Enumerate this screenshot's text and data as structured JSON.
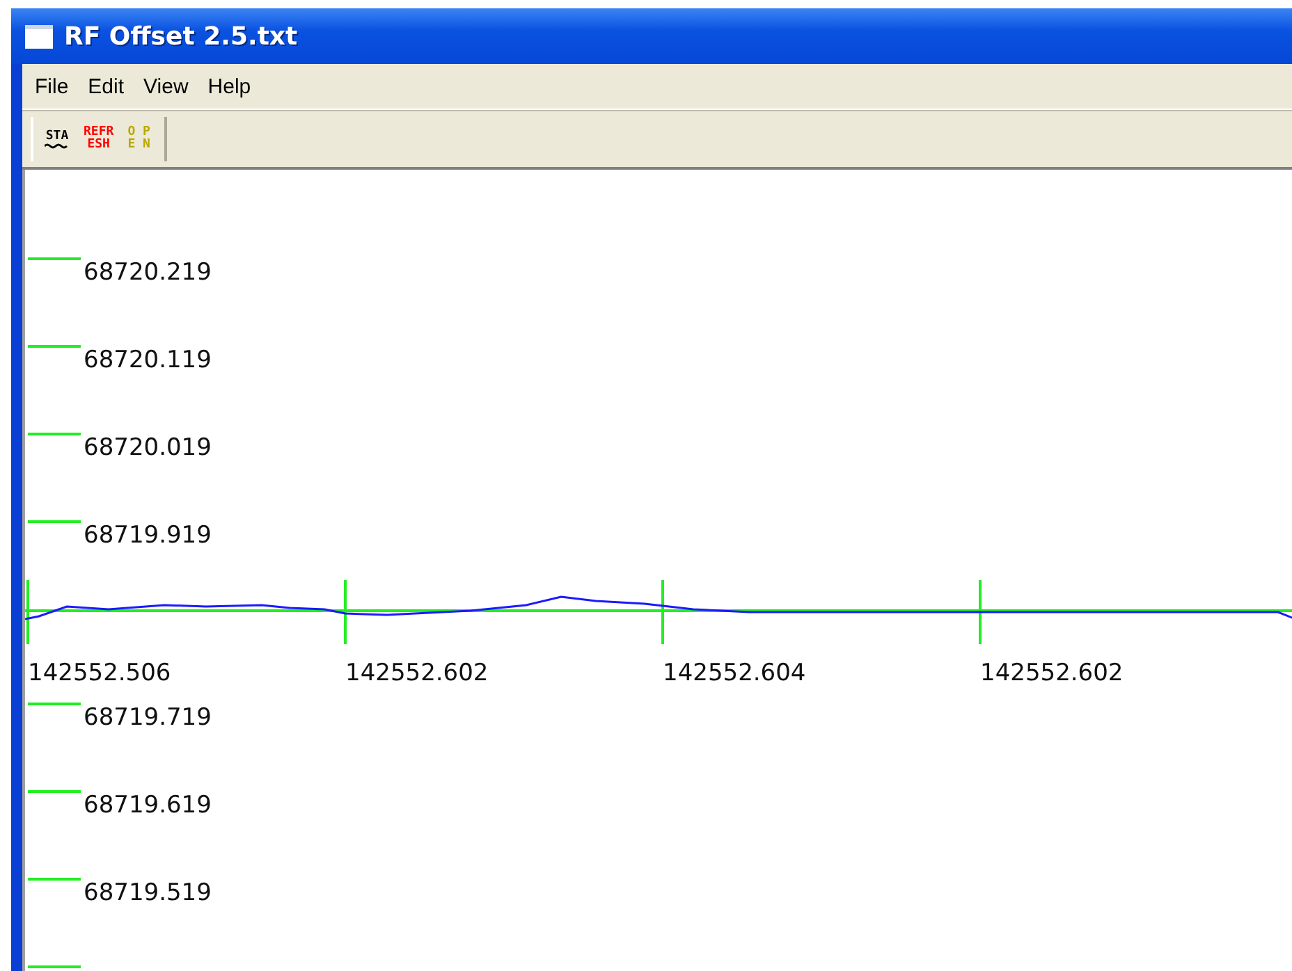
{
  "window": {
    "title": "RF Offset 2.5.txt"
  },
  "menu": [
    "File",
    "Edit",
    "View",
    "Help"
  ],
  "toolbar": [
    {
      "lines": [
        "STA"
      ],
      "color": "#000000",
      "wavy": true
    },
    {
      "lines": [
        "REFR",
        "ESH"
      ],
      "color": "#ff0000",
      "wavy": false
    },
    {
      "lines": [
        "O P",
        "E N"
      ],
      "color": "#b8a800",
      "wavy": false
    }
  ],
  "plot": {
    "upper_labels": [
      "68720.219",
      "68720.119",
      "68720.019",
      "68719.919"
    ],
    "lower_labels": [
      "68719.719",
      "68719.619",
      "68719.519"
    ],
    "x_labels": [
      "142552.506",
      "142552.602",
      "142552.604",
      "142552.602"
    ]
  }
}
